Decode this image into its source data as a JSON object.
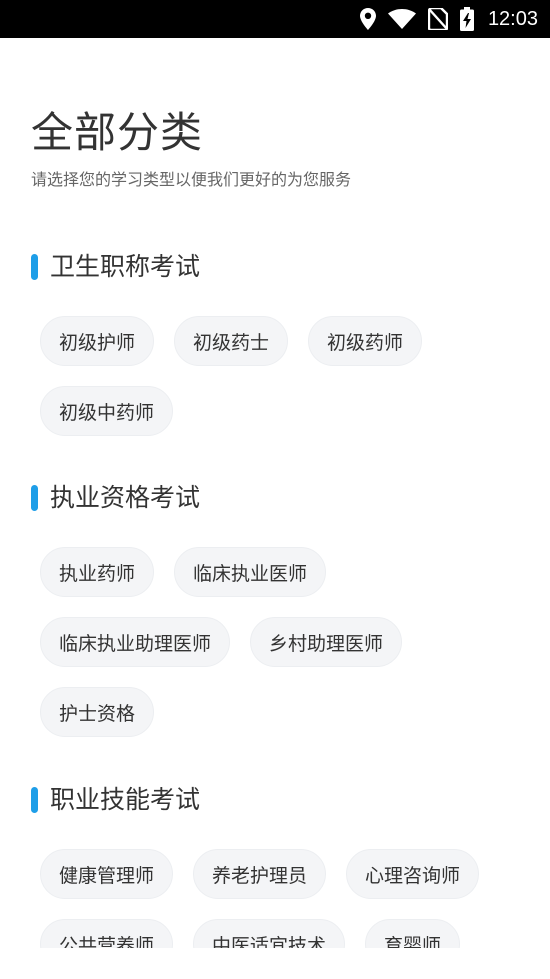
{
  "status_bar": {
    "time": "12:03",
    "icons": [
      "location-icon",
      "wifi-icon",
      "no-sim-icon",
      "battery-charging-icon"
    ]
  },
  "page": {
    "title": "全部分类",
    "subtitle": "请选择您的学习类型以便我们更好的为您服务"
  },
  "colors": {
    "accent": "#1e9ee8",
    "chip_bg": "#f4f5f7",
    "text": "#333333"
  },
  "sections": [
    {
      "title": "卫生职称考试",
      "items": [
        "初级护师",
        "初级药士",
        "初级药师",
        "初级中药师"
      ]
    },
    {
      "title": "执业资格考试",
      "items": [
        "执业药师",
        "临床执业医师",
        "临床执业助理医师",
        "乡村助理医师",
        "护士资格"
      ]
    },
    {
      "title": "职业技能考试",
      "items": [
        "健康管理师",
        "养老护理员",
        "心理咨询师",
        "公共营养师",
        "中医适宜技术",
        "育婴师"
      ]
    }
  ]
}
